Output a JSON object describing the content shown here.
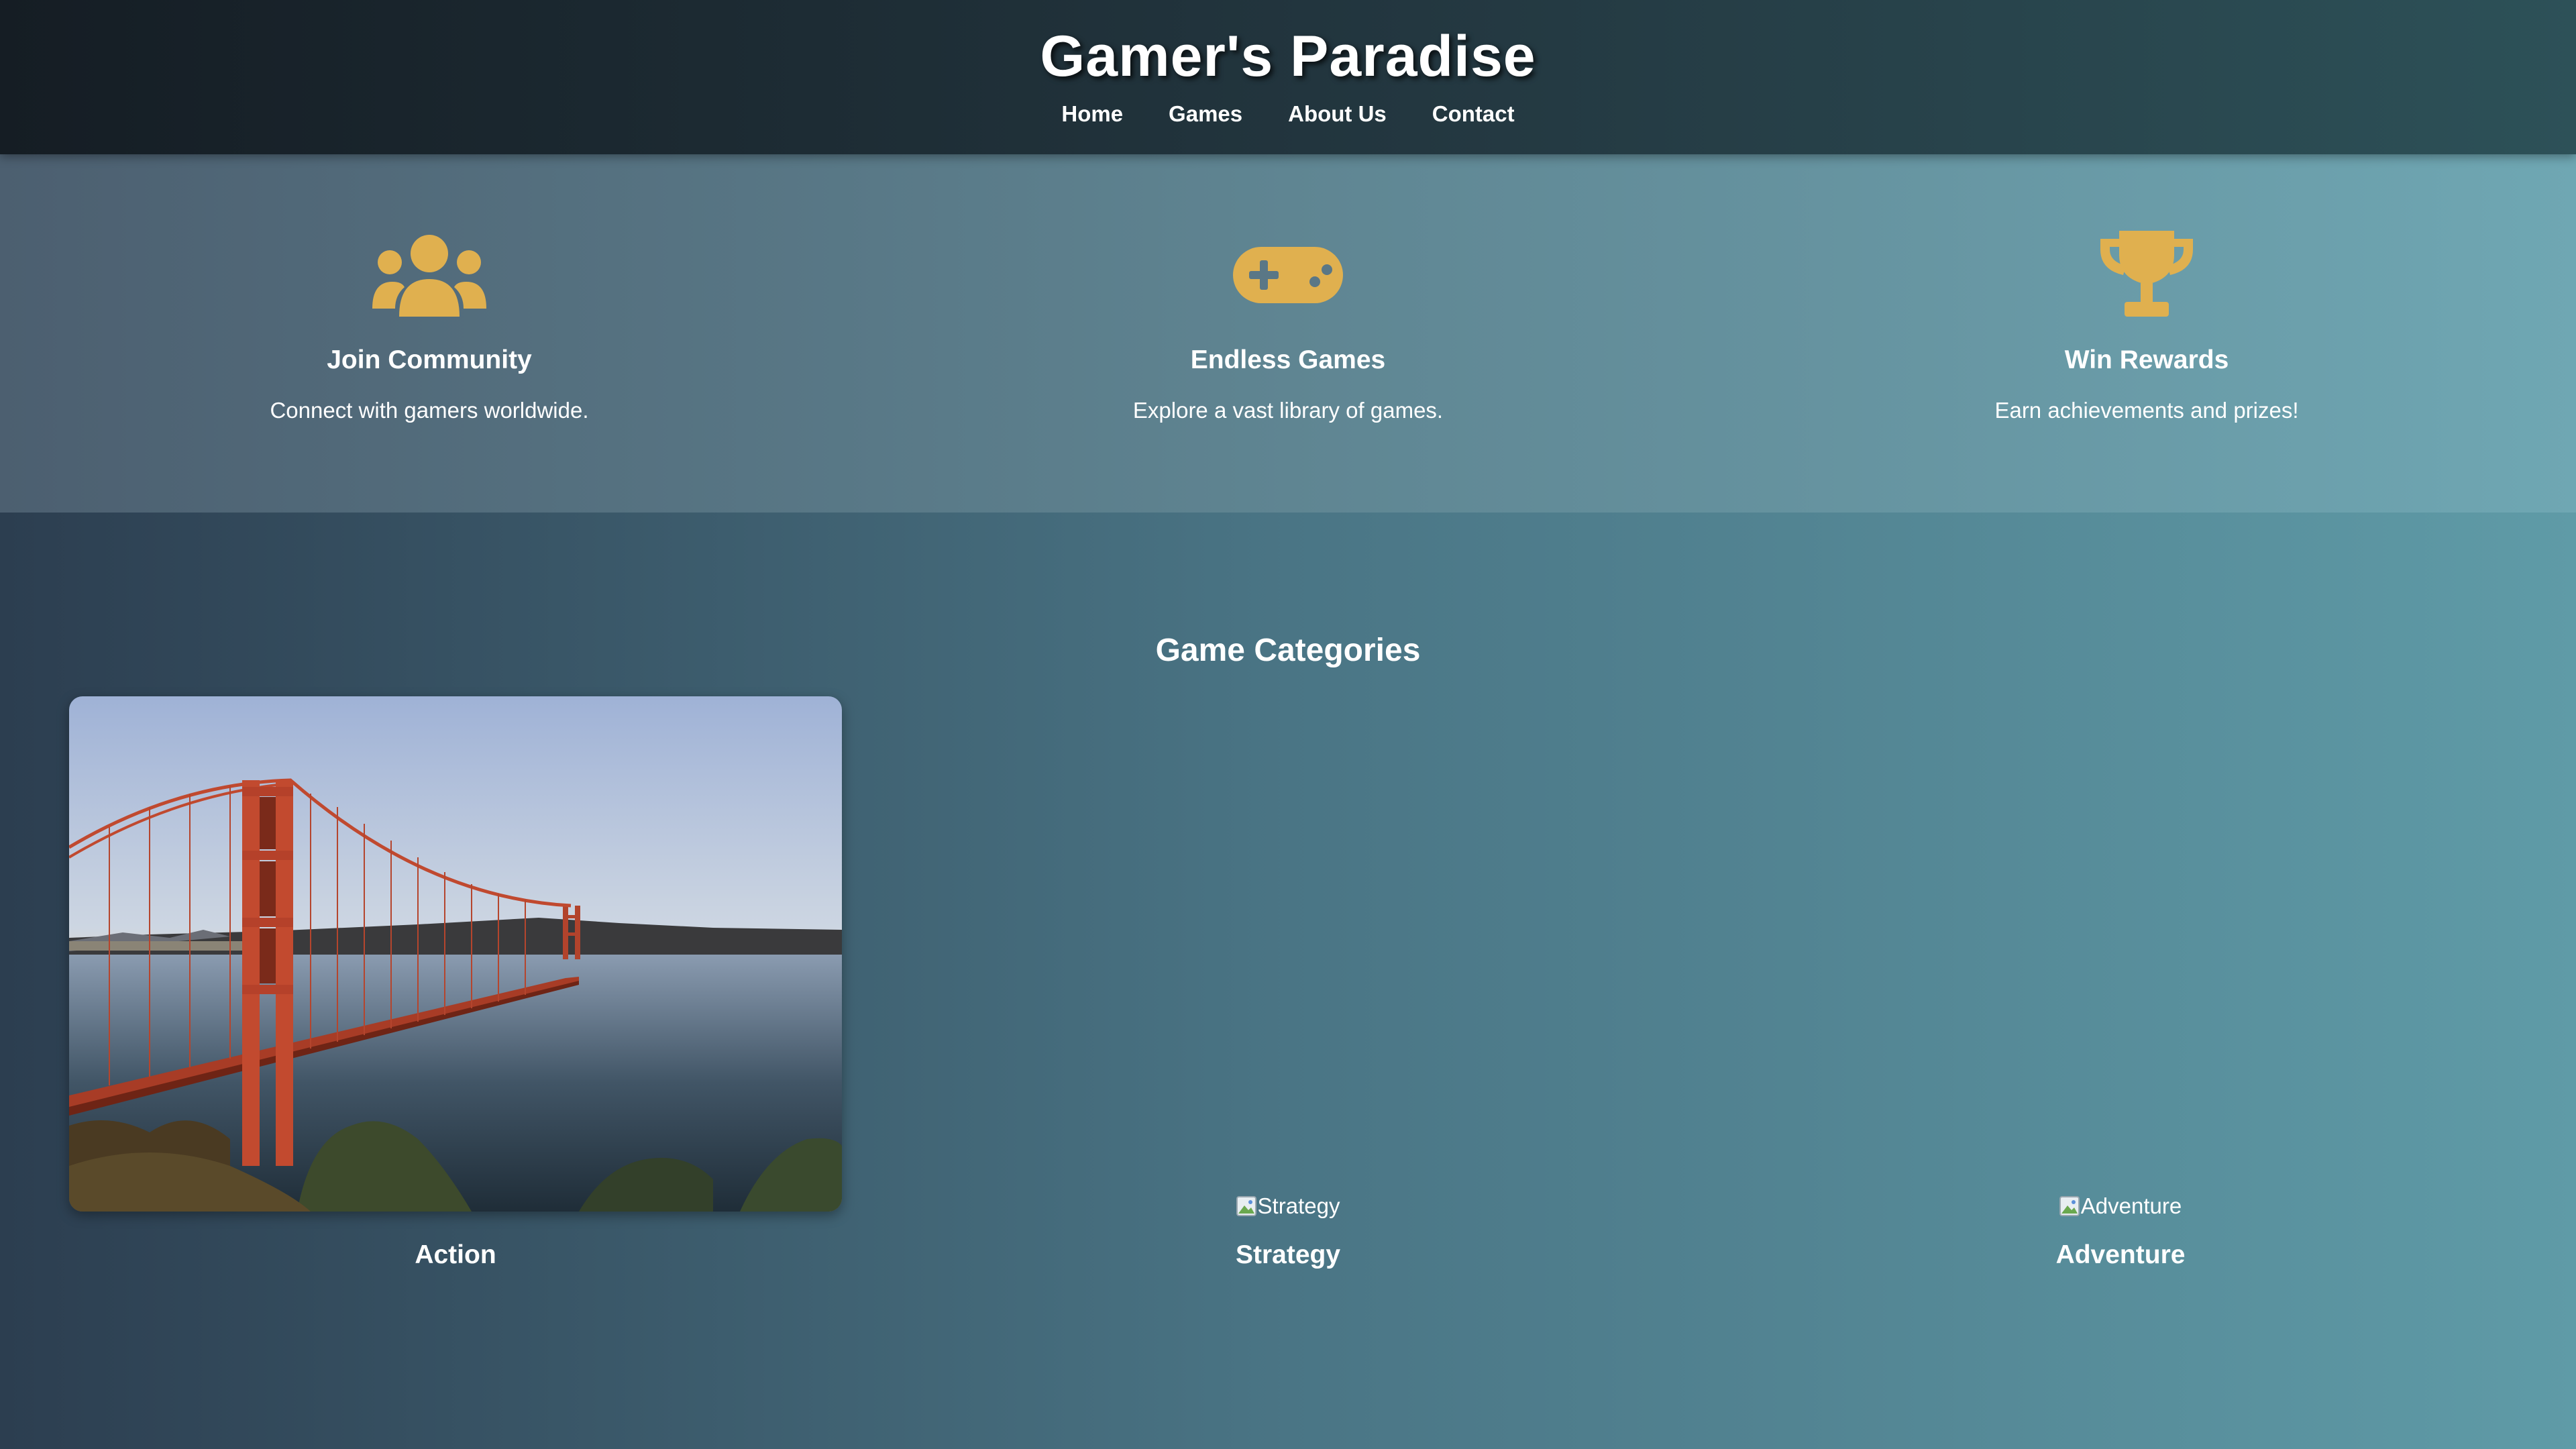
{
  "header": {
    "title": "Gamer's Paradise",
    "nav": [
      {
        "label": "Home"
      },
      {
        "label": "Games"
      },
      {
        "label": "About Us"
      },
      {
        "label": "Contact"
      }
    ]
  },
  "features": [
    {
      "icon": "users-icon",
      "title": "Join Community",
      "description": "Connect with gamers worldwide."
    },
    {
      "icon": "gamepad-icon",
      "title": "Endless Games",
      "description": "Explore a vast library of games."
    },
    {
      "icon": "trophy-icon",
      "title": "Win Rewards",
      "description": "Earn achievements and prizes!"
    }
  ],
  "categories": {
    "title": "Game Categories",
    "items": [
      {
        "name": "Action",
        "image": "golden-gate-bridge-photo",
        "alt": ""
      },
      {
        "name": "Strategy",
        "image": "broken-image-icon",
        "alt": "Strategy"
      },
      {
        "name": "Adventure",
        "image": "broken-image-icon",
        "alt": "Adventure"
      }
    ]
  },
  "colors": {
    "accent": "#e0b04f",
    "header_bg": "#1a252e",
    "text": "#ffffff"
  }
}
